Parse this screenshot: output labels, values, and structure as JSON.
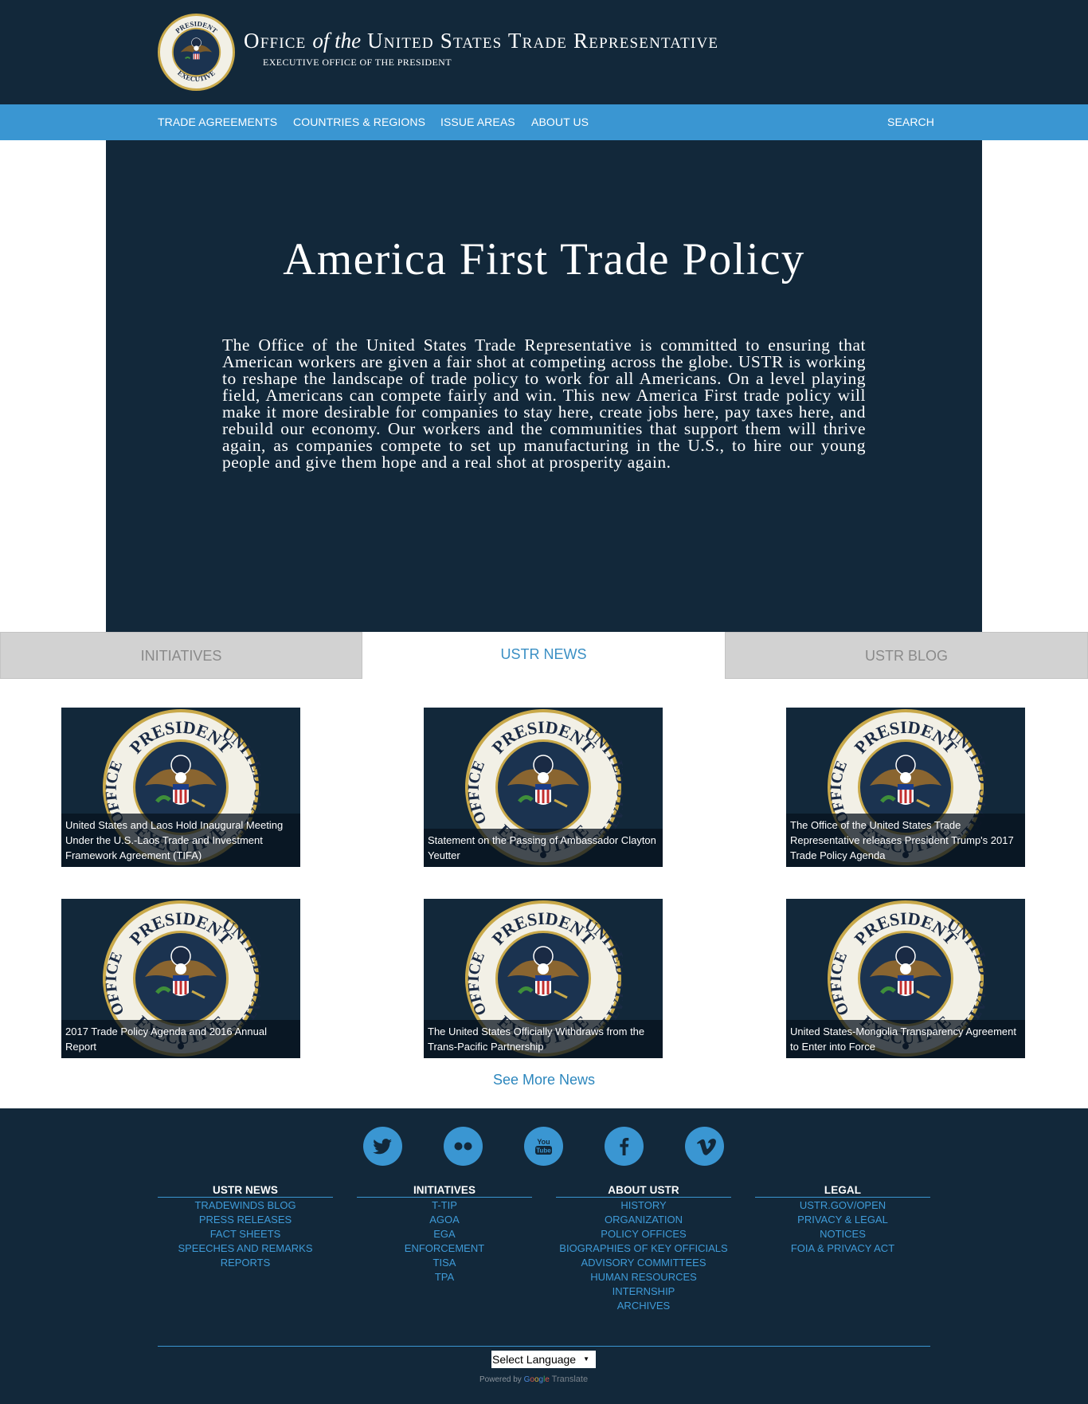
{
  "header": {
    "title_part1": "Office",
    "title_part2": "of the",
    "title_part3": "United States Trade Representative",
    "subtitle": "EXECUTIVE OFFICE OF THE PRESIDENT",
    "seal_text_top": "PRESIDENT",
    "seal_text_left": "OFFICE",
    "seal_text_bottom": "EXECUTIVE",
    "seal_text_right": "UNITED STATES"
  },
  "nav": {
    "items": [
      "TRADE AGREEMENTS",
      "COUNTRIES & REGIONS",
      "ISSUE AREAS",
      "ABOUT US"
    ],
    "search_label": "SEARCH"
  },
  "hero": {
    "title": "America First Trade Policy",
    "body": "The Office of the United States Trade Representative is committed to ensuring that American workers are given a fair shot at competing across the globe. USTR is working to reshape the landscape of trade policy to work for all Americans. On a level playing field, Americans can compete fairly and win. This new America First trade policy will make it more desirable for companies to stay here, create jobs here, pay taxes here, and rebuild our economy.  Our workers and the communities that support them will thrive again, as companies compete to set up manufacturing in the U.S., to hire our young people and give them hope and a real shot at prosperity again."
  },
  "tabs": [
    {
      "label": "INITIATIVES",
      "active": false
    },
    {
      "label": "USTR NEWS",
      "active": true
    },
    {
      "label": "USTR BLOG",
      "active": false
    }
  ],
  "news": [
    {
      "caption": "United States and Laos Hold Inaugural Meeting Under the U.S.-Laos Trade and Investment Framework Agreement (TIFA)"
    },
    {
      "caption": "Statement on the Passing of Ambassador Clayton Yeutter"
    },
    {
      "caption": "The Office of the United States Trade Representative releases President Trump's 2017 Trade Policy Agenda"
    },
    {
      "caption": "2017 Trade Policy Agenda and 2016 Annual Report"
    },
    {
      "caption": "The United States Officially Withdraws from the Trans-Pacific Partnership"
    },
    {
      "caption": "United States-Mongolia Transparency Agreement to Enter into Force"
    }
  ],
  "see_more": "See More News",
  "footer": {
    "social": [
      "twitter-icon",
      "flickr-icon",
      "youtube-icon",
      "facebook-icon",
      "vimeo-icon"
    ],
    "youtube_text_1": "You",
    "youtube_text_2": "Tube",
    "columns": [
      {
        "heading": "USTR NEWS",
        "links": [
          "TRADEWINDS BLOG",
          "PRESS RELEASES",
          "FACT SHEETS",
          "SPEECHES AND REMARKS",
          "REPORTS"
        ]
      },
      {
        "heading": "INITIATIVES",
        "links": [
          "T-TIP",
          "AGOA",
          "EGA",
          "ENFORCEMENT",
          "TISA",
          "TPA"
        ]
      },
      {
        "heading": "ABOUT USTR",
        "links": [
          "HISTORY",
          "ORGANIZATION",
          "POLICY OFFICES",
          "BIOGRAPHIES OF KEY OFFICIALS",
          "ADVISORY COMMITTEES",
          "HUMAN RESOURCES",
          "INTERNSHIP",
          "ARCHIVES"
        ]
      },
      {
        "heading": "LEGAL",
        "links": [
          "USTR.GOV/OPEN",
          "PRIVACY & LEGAL",
          "NOTICES",
          "FOIA & PRIVACY ACT"
        ]
      }
    ],
    "language_select": "Select Language",
    "powered_by": "Powered by",
    "google_letters": [
      "G",
      "o",
      "o",
      "g",
      "l",
      "e"
    ],
    "translate": "Translate"
  },
  "colors": {
    "navy": "#12283a",
    "nav_blue": "#3a96d2",
    "link_blue": "#3f9bd8",
    "tab_grey": "#d2d2d2"
  }
}
